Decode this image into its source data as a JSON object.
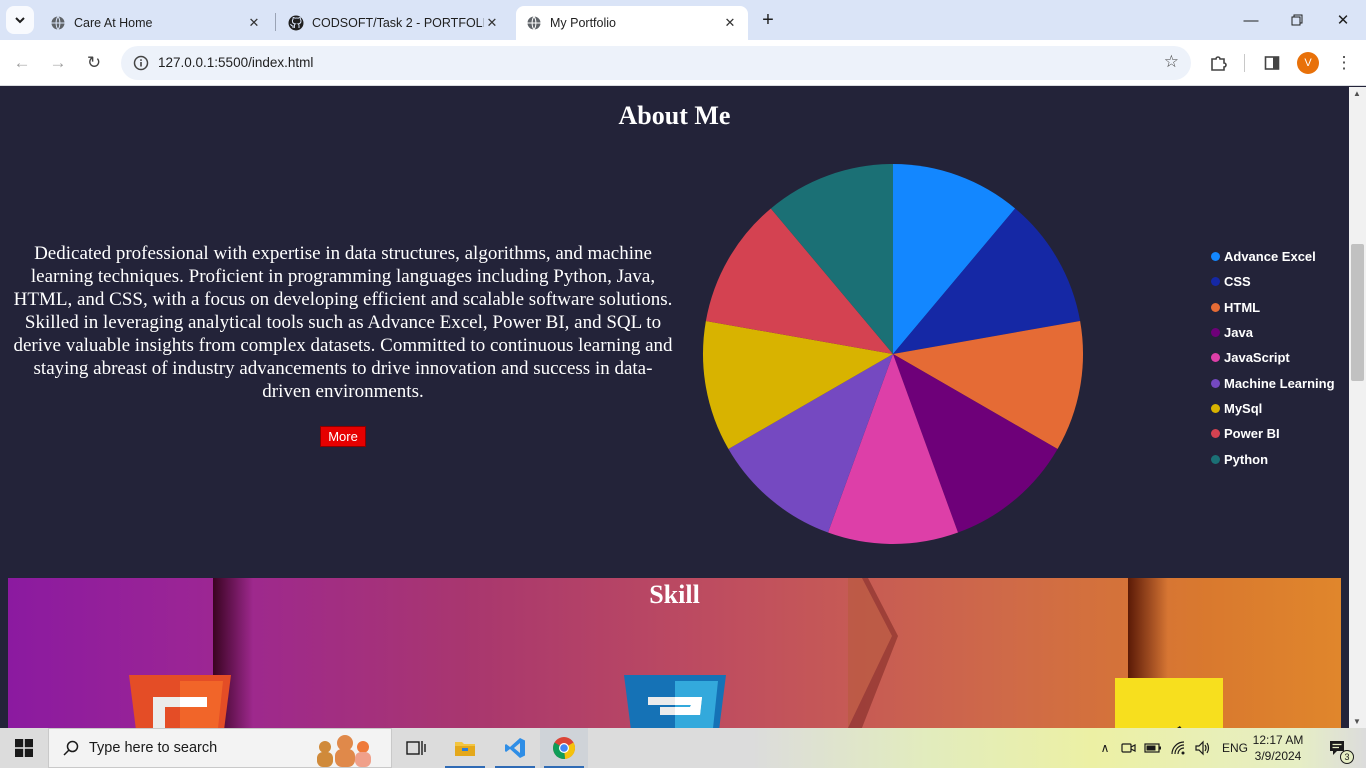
{
  "browser": {
    "tabs": [
      {
        "title": "Care At Home",
        "icon": "globe-icon",
        "active": false
      },
      {
        "title": "CODSOFT/Task 2 - PORTFOLIO",
        "icon": "github-icon",
        "active": false
      },
      {
        "title": "My Portfolio",
        "icon": "globe-icon",
        "active": true
      }
    ],
    "url": "127.0.0.1:5500/index.html",
    "profile_initial": "V"
  },
  "page": {
    "about": {
      "title": "About Me",
      "text": "Dedicated professional with expertise in data structures, algorithms, and machine learning techniques. Proficient in programming languages including Python, Java, HTML, and CSS, with a focus on developing efficient and scalable software solutions. Skilled in leveraging analytical tools such as Advance Excel, Power BI, and SQL to derive valuable insights from complex datasets. Committed to continuous learning and staying abreast of industry advancements to drive innovation and success in data-driven environments.",
      "more_label": "More"
    },
    "skill": {
      "title": "Skill"
    }
  },
  "chart_data": {
    "type": "pie",
    "categories": [
      "Advance Excel",
      "CSS",
      "HTML",
      "Java",
      "JavaScript",
      "Machine Learning",
      "MySql",
      "Power BI",
      "Python"
    ],
    "values": [
      1,
      1,
      1,
      1,
      1,
      1,
      1,
      1,
      1
    ],
    "colors": [
      "#1387ff",
      "#1528a5",
      "#e56b35",
      "#6e0079",
      "#dd3fa8",
      "#7549c1",
      "#d8b300",
      "#d44251",
      "#1b7075"
    ],
    "legend": "right"
  },
  "taskbar": {
    "search_placeholder": "Type here to search",
    "language": "ENG",
    "time": "12:17 AM",
    "date": "3/9/2024",
    "notification_count": "3"
  }
}
